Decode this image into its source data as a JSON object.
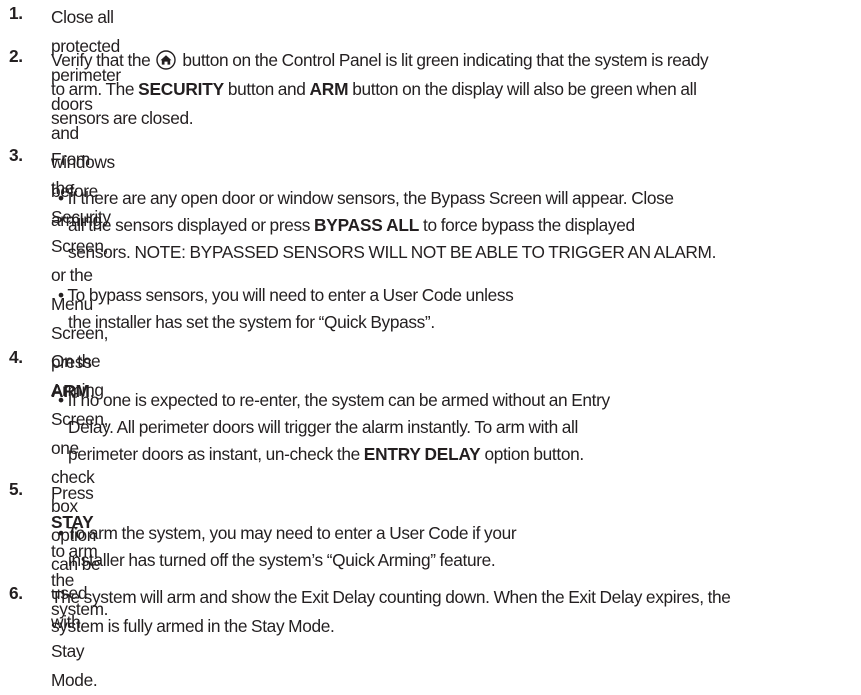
{
  "steps": [
    {
      "num": "1.",
      "lines": [
        "Close all protected perimeter doors and windows before arming."
      ]
    },
    {
      "num": "2.",
      "parts": {
        "a": "Verify that the",
        "b": "button on the Control Panel is lit green indicating that the system is ready",
        "c": "to arm. The",
        "d": "SECURITY",
        "e": "button and",
        "f": "ARM",
        "g": "button on the display will also be green when all",
        "h": "sensors are closed."
      },
      "icon": "home-button-icon"
    },
    {
      "num": "3.",
      "parts": {
        "a": "From the Security Screen, or the Menu Screen, press",
        "b": "ARM",
        "c": "."
      },
      "bullets": [
        {
          "l1": "• If there are any open door or window sensors, the Bypass Screen will appear. Close",
          "l2a": "all the sensors displayed or press",
          "l2b": "BYPASS ALL",
          "l2c": "to force bypass the displayed",
          "l3": "sensors. NOTE: BYPASSED SENSORS WILL NOT BE ABLE TO TRIGGER AN ALARM."
        },
        {
          "l1": "• To bypass sensors, you will need to enter a User Code unless",
          "l2": "the installer has set the system for “Quick Bypass”."
        }
      ]
    },
    {
      "num": "4.",
      "lines": [
        "On the Arming Screen, one check box option can be used with Stay Mode."
      ],
      "bullet": {
        "l1": "• If no one is expected to re-enter, the system can be armed without an Entry",
        "l2": "Delay. All perimeter doors will trigger the alarm instantly. To arm with all",
        "l3a": "perimeter doors as instant, un-check the",
        "l3b": "ENTRY DELAY",
        "l3c": "option button."
      }
    },
    {
      "num": "5.",
      "parts": {
        "a": "Press",
        "b": "STAY",
        "c": "to arm the system."
      },
      "bullet": {
        "l1": "• To arm the system, you may need to enter a User Code if your",
        "l2": "installer has turned off the system’s “Quick Arming” feature."
      }
    },
    {
      "num": "6.",
      "lines": [
        "The system will arm and show the Exit Delay counting down. When the Exit Delay expires, the",
        "system is fully armed in the Stay Mode."
      ]
    }
  ]
}
